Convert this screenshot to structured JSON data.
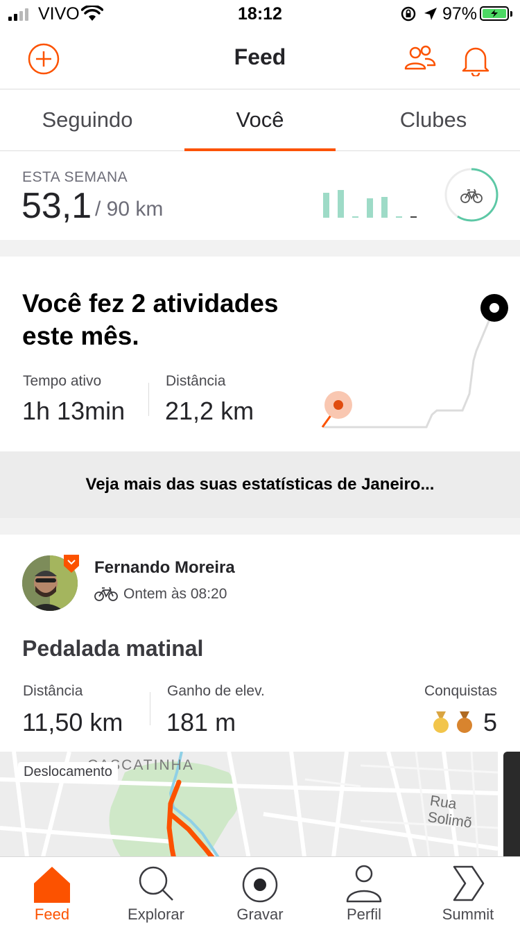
{
  "status_bar": {
    "carrier": "VIVO",
    "time": "18:12",
    "battery": "97%"
  },
  "header": {
    "title": "Feed"
  },
  "tabs": [
    {
      "label": "Seguindo"
    },
    {
      "label": "Você"
    },
    {
      "label": "Clubes"
    }
  ],
  "week_summary": {
    "label": "ESTA SEMANA",
    "value": "53,1",
    "goal": "/ 90 km",
    "bars": [
      0.9,
      1.0,
      0.05,
      0.7,
      0.75,
      0.05,
      0.05
    ],
    "progress": 0.59
  },
  "month_summary": {
    "title": "Você fez 2 atividades este mês.",
    "time_label": "Tempo ativo",
    "time_value": "1h 13min",
    "distance_label": "Distância",
    "distance_value": "21,2 km",
    "more_link": "Veja mais das suas estatísticas de Janeiro..."
  },
  "activity": {
    "athlete": "Fernando Moreira",
    "meta": "Ontem às 08:20",
    "title": "Pedalada matinal",
    "distance_label": "Distância",
    "distance_value": "11,50 km",
    "elevation_label": "Ganho de elev.",
    "elevation_value": "181 m",
    "achievements_label": "Conquistas",
    "achievements_count": "5",
    "map_tag": "Deslocamento",
    "map_label_top": "CASCATINHA",
    "map_label_street": "Rua Solimõ"
  },
  "tab_bar": [
    {
      "label": "Feed"
    },
    {
      "label": "Explorar"
    },
    {
      "label": "Gravar"
    },
    {
      "label": "Perfil"
    },
    {
      "label": "Summit"
    }
  ],
  "colors": {
    "accent": "#fc5200",
    "goal_green": "#5cc8a5",
    "bar_green": "#9edbc7"
  }
}
